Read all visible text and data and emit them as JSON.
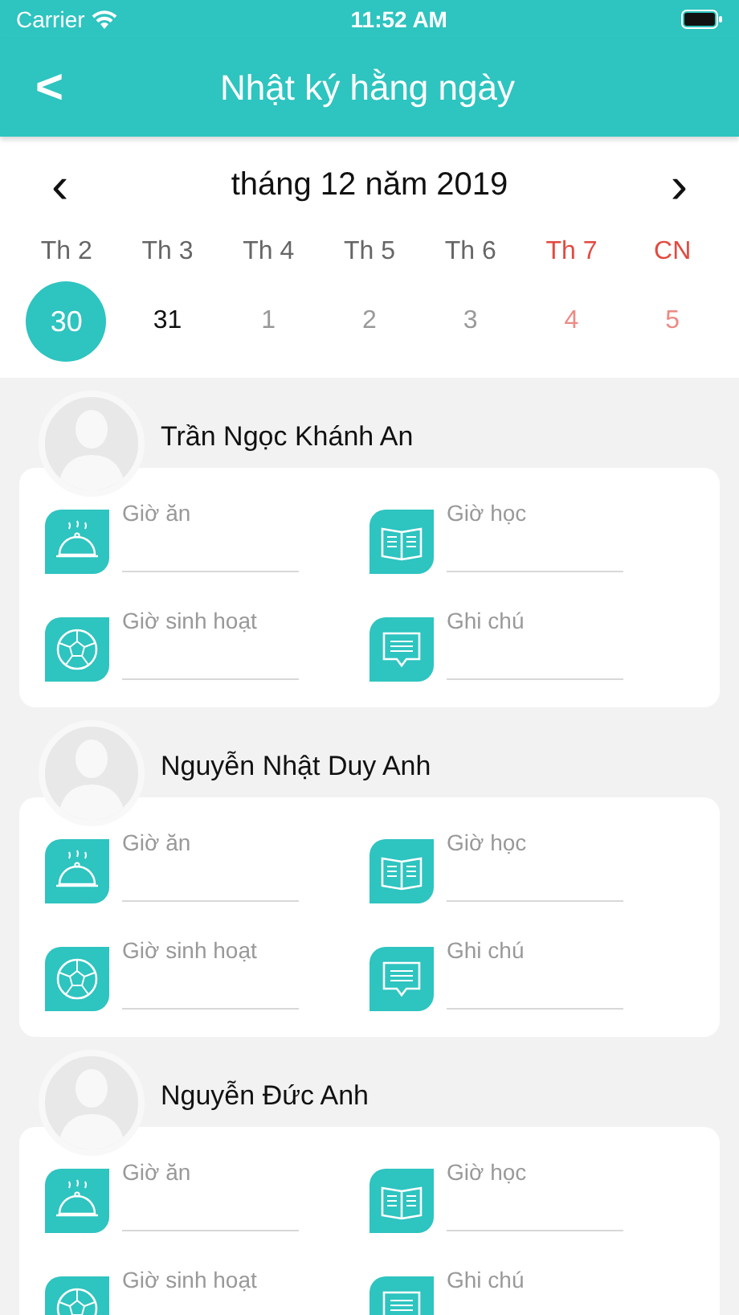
{
  "status_bar": {
    "carrier": "Carrier",
    "time": "11:52 AM"
  },
  "nav": {
    "back": "<",
    "title": "Nhật ký hằng ngày"
  },
  "calendar": {
    "prev": "‹",
    "month": "tháng 12 năm 2019",
    "next": "›",
    "weekdays": [
      {
        "label": "Th 2",
        "weekend": false
      },
      {
        "label": "Th 3",
        "weekend": false
      },
      {
        "label": "Th 4",
        "weekend": false
      },
      {
        "label": "Th 5",
        "weekend": false
      },
      {
        "label": "Th 6",
        "weekend": false
      },
      {
        "label": "Th 7",
        "weekend": true
      },
      {
        "label": "CN",
        "weekend": true
      }
    ],
    "days": [
      {
        "label": "30",
        "selected": true,
        "in_month": true,
        "weekend": false
      },
      {
        "label": "31",
        "selected": false,
        "in_month": true,
        "weekend": false
      },
      {
        "label": "1",
        "selected": false,
        "in_month": false,
        "weekend": false
      },
      {
        "label": "2",
        "selected": false,
        "in_month": false,
        "weekend": false
      },
      {
        "label": "3",
        "selected": false,
        "in_month": false,
        "weekend": false
      },
      {
        "label": "4",
        "selected": false,
        "in_month": false,
        "weekend": true
      },
      {
        "label": "5",
        "selected": false,
        "in_month": false,
        "weekend": true
      }
    ]
  },
  "students": [
    {
      "name": "Trần Ngọc Khánh An",
      "fields": [
        {
          "kind": "meal",
          "label": "Giờ ăn"
        },
        {
          "kind": "study",
          "label": "Giờ học"
        },
        {
          "kind": "activity",
          "label": "Giờ sinh hoạt"
        },
        {
          "kind": "note",
          "label": "Ghi chú"
        }
      ]
    },
    {
      "name": "Nguyễn Nhật Duy Anh",
      "fields": [
        {
          "kind": "meal",
          "label": "Giờ ăn"
        },
        {
          "kind": "study",
          "label": "Giờ học"
        },
        {
          "kind": "activity",
          "label": "Giờ sinh hoạt"
        },
        {
          "kind": "note",
          "label": "Ghi chú"
        }
      ]
    },
    {
      "name": "Nguyễn Đức Anh",
      "fields": [
        {
          "kind": "meal",
          "label": "Giờ ăn"
        },
        {
          "kind": "study",
          "label": "Giờ học"
        },
        {
          "kind": "activity",
          "label": "Giờ sinh hoạt"
        },
        {
          "kind": "note",
          "label": "Ghi chú"
        }
      ]
    }
  ]
}
